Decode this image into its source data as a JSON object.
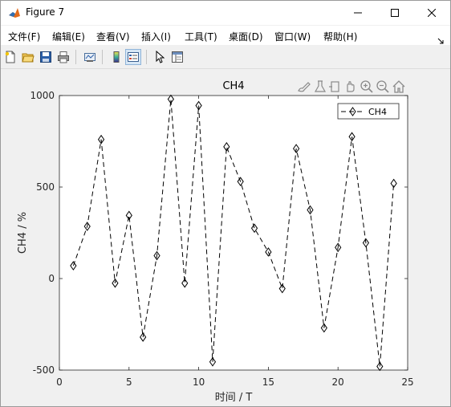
{
  "window": {
    "title": "Figure 7",
    "controls": {
      "minimize": "minimize-icon",
      "maximize": "maximize-icon",
      "close": "close-icon"
    }
  },
  "menubar": {
    "items": [
      {
        "label": "文件(F)"
      },
      {
        "label": "编辑(E)"
      },
      {
        "label": "查看(V)"
      },
      {
        "label": "插入(I)"
      },
      {
        "label": "工具(T)"
      },
      {
        "label": "桌面(D)"
      },
      {
        "label": "窗口(W)"
      },
      {
        "label": "帮助(H)"
      }
    ]
  },
  "toolbar": {
    "buttons": [
      "new-figure-icon",
      "open-file-icon",
      "save-icon",
      "print-icon",
      "link-plot-icon",
      "colorbar-icon",
      "legend-icon",
      "pointer-icon",
      "property-editor-icon"
    ]
  },
  "axes_toolbar": {
    "buttons": [
      "brush-icon",
      "data-tip-icon",
      "rotate-icon",
      "pan-icon",
      "zoom-in-icon",
      "zoom-out-icon",
      "home-icon"
    ]
  },
  "chart_data": {
    "type": "line",
    "title": "CH4",
    "xlabel": "时间 / T",
    "ylabel": "CH4 / %",
    "xlim": [
      0,
      25
    ],
    "ylim": [
      -500,
      1000
    ],
    "xticks": [
      "0",
      "5",
      "10",
      "15",
      "20",
      "25"
    ],
    "yticks": [
      "-500",
      "0",
      "500",
      "1000"
    ],
    "line_style": "dashed",
    "marker": "diamond",
    "line_color": "#000000",
    "grid": false,
    "legend": {
      "position": "top-right",
      "entries": [
        "CH4"
      ]
    },
    "series": [
      {
        "name": "CH4",
        "x": [
          1,
          2,
          3,
          4,
          5,
          6,
          7,
          8,
          9,
          10,
          11,
          12,
          13,
          14,
          15,
          16,
          17,
          18,
          19,
          20,
          21,
          22,
          23,
          24
        ],
        "values": [
          70,
          285,
          760,
          -25,
          345,
          -320,
          125,
          980,
          -25,
          945,
          -455,
          720,
          530,
          275,
          145,
          -55,
          710,
          375,
          -270,
          170,
          775,
          195,
          -480,
          520
        ]
      }
    ]
  }
}
